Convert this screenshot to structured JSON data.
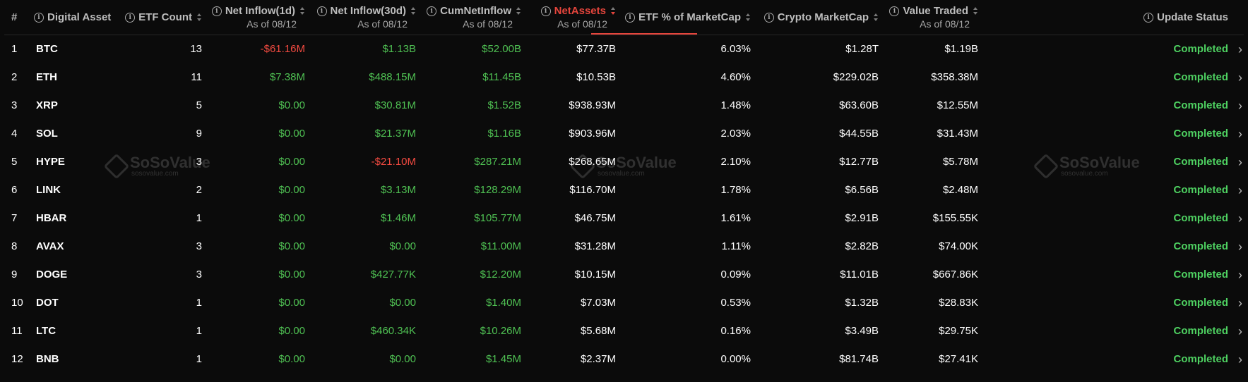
{
  "columns": {
    "index": "#",
    "asset": "Digital Asset",
    "etf_count": "ETF Count",
    "inflow_1d": "Net Inflow(1d)",
    "inflow_30d": "Net Inflow(30d)",
    "cum_inflow": "CumNetInflow",
    "net_assets": "NetAssets",
    "etf_pct": "ETF % of MarketCap",
    "crypto_mcap": "Crypto MarketCap",
    "value_traded": "Value Traded",
    "update_status": "Update Status",
    "as_of": "As of 08/12"
  },
  "rows": [
    {
      "idx": "1",
      "asset": "BTC",
      "etf_count": "13",
      "inflow_1d": "-$61.16M",
      "inflow_30d": "$1.13B",
      "cum": "$52.00B",
      "net_assets": "$77.37B",
      "pct": "6.03%",
      "mcap": "$1.28T",
      "traded": "$1.19B",
      "status": "Completed"
    },
    {
      "idx": "2",
      "asset": "ETH",
      "etf_count": "11",
      "inflow_1d": "$7.38M",
      "inflow_30d": "$488.15M",
      "cum": "$11.45B",
      "net_assets": "$10.53B",
      "pct": "4.60%",
      "mcap": "$229.02B",
      "traded": "$358.38M",
      "status": "Completed"
    },
    {
      "idx": "3",
      "asset": "XRP",
      "etf_count": "5",
      "inflow_1d": "$0.00",
      "inflow_30d": "$30.81M",
      "cum": "$1.52B",
      "net_assets": "$938.93M",
      "pct": "1.48%",
      "mcap": "$63.60B",
      "traded": "$12.55M",
      "status": "Completed"
    },
    {
      "idx": "4",
      "asset": "SOL",
      "etf_count": "9",
      "inflow_1d": "$0.00",
      "inflow_30d": "$21.37M",
      "cum": "$1.16B",
      "net_assets": "$903.96M",
      "pct": "2.03%",
      "mcap": "$44.55B",
      "traded": "$31.43M",
      "status": "Completed"
    },
    {
      "idx": "5",
      "asset": "HYPE",
      "etf_count": "3",
      "inflow_1d": "$0.00",
      "inflow_30d": "-$21.10M",
      "cum": "$287.21M",
      "net_assets": "$268.65M",
      "pct": "2.10%",
      "mcap": "$12.77B",
      "traded": "$5.78M",
      "status": "Completed"
    },
    {
      "idx": "6",
      "asset": "LINK",
      "etf_count": "2",
      "inflow_1d": "$0.00",
      "inflow_30d": "$3.13M",
      "cum": "$128.29M",
      "net_assets": "$116.70M",
      "pct": "1.78%",
      "mcap": "$6.56B",
      "traded": "$2.48M",
      "status": "Completed"
    },
    {
      "idx": "7",
      "asset": "HBAR",
      "etf_count": "1",
      "inflow_1d": "$0.00",
      "inflow_30d": "$1.46M",
      "cum": "$105.77M",
      "net_assets": "$46.75M",
      "pct": "1.61%",
      "mcap": "$2.91B",
      "traded": "$155.55K",
      "status": "Completed"
    },
    {
      "idx": "8",
      "asset": "AVAX",
      "etf_count": "3",
      "inflow_1d": "$0.00",
      "inflow_30d": "$0.00",
      "cum": "$11.00M",
      "net_assets": "$31.28M",
      "pct": "1.11%",
      "mcap": "$2.82B",
      "traded": "$74.00K",
      "status": "Completed"
    },
    {
      "idx": "9",
      "asset": "DOGE",
      "etf_count": "3",
      "inflow_1d": "$0.00",
      "inflow_30d": "$427.77K",
      "cum": "$12.20M",
      "net_assets": "$10.15M",
      "pct": "0.09%",
      "mcap": "$11.01B",
      "traded": "$667.86K",
      "status": "Completed"
    },
    {
      "idx": "10",
      "asset": "DOT",
      "etf_count": "1",
      "inflow_1d": "$0.00",
      "inflow_30d": "$0.00",
      "cum": "$1.40M",
      "net_assets": "$7.03M",
      "pct": "0.53%",
      "mcap": "$1.32B",
      "traded": "$28.83K",
      "status": "Completed"
    },
    {
      "idx": "11",
      "asset": "LTC",
      "etf_count": "1",
      "inflow_1d": "$0.00",
      "inflow_30d": "$460.34K",
      "cum": "$10.26M",
      "net_assets": "$5.68M",
      "pct": "0.16%",
      "mcap": "$3.49B",
      "traded": "$29.75K",
      "status": "Completed"
    },
    {
      "idx": "12",
      "asset": "BNB",
      "etf_count": "1",
      "inflow_1d": "$0.00",
      "inflow_30d": "$0.00",
      "cum": "$1.45M",
      "net_assets": "$2.37M",
      "pct": "0.00%",
      "mcap": "$81.74B",
      "traded": "$27.41K",
      "status": "Completed"
    }
  ],
  "watermark": {
    "brand": "SoSoValue",
    "domain": "sosovalue.com"
  },
  "colors": {
    "positive": "#4fc153",
    "negative": "#f24a40",
    "active_sort": "#e5453c",
    "status": "#4ed161",
    "background": "#0b0b0b"
  },
  "icons": {
    "info": "info-circle-icon",
    "sort": "sort-icon",
    "row_action": "chevron-right-icon"
  }
}
